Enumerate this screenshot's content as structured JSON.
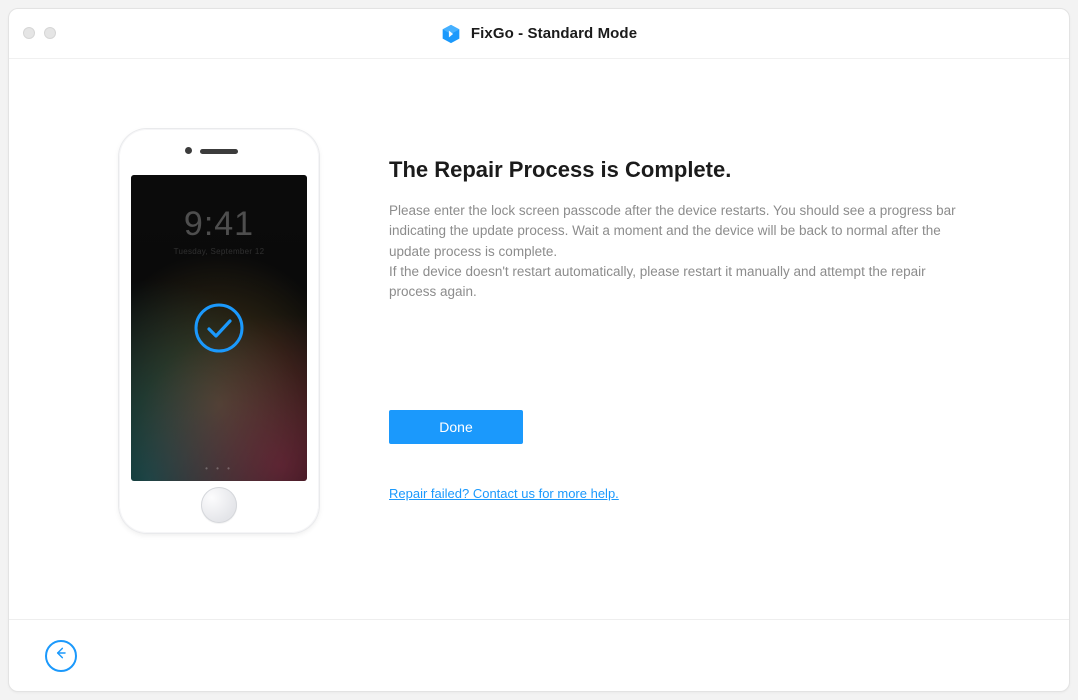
{
  "window": {
    "title": "FixGo - Standard Mode"
  },
  "phone": {
    "lock_time": "9:41",
    "lock_date": "Tuesday, September 12"
  },
  "main": {
    "heading": "The Repair Process is Complete.",
    "description_p1": "Please enter the lock screen passcode after the device restarts. You should see a progress bar indicating the update process. Wait a moment and the device will be back to normal after the update process is complete.",
    "description_p2": "If the device doesn't restart automatically, please restart it manually and attempt the repair process again.",
    "done_label": "Done",
    "help_link": "Repair failed? Contact us for more help."
  },
  "colors": {
    "accent": "#1b99fc"
  }
}
